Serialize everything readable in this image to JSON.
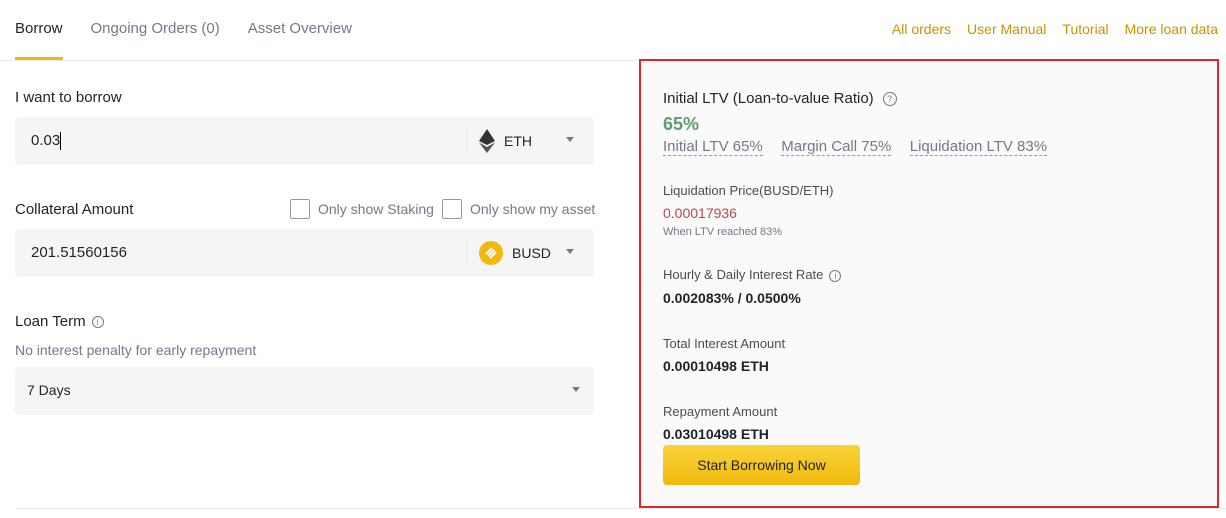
{
  "tabs": [
    "Borrow",
    "Ongoing Orders (0)",
    "Asset Overview"
  ],
  "links": [
    "All orders",
    "User Manual",
    "Tutorial",
    "More loan data"
  ],
  "borrow": {
    "label": "I want to borrow",
    "value": "0.03",
    "coin": "ETH"
  },
  "collateral": {
    "label": "Collateral Amount",
    "staking": "Only show Staking",
    "myasset": "Only show my asset",
    "value": "201.51560156",
    "coin": "BUSD"
  },
  "term": {
    "label": "Loan Term",
    "note": "No interest penalty for early repayment",
    "value": "7 Days"
  },
  "panel": {
    "ltv_title": "Initial LTV (Loan-to-value Ratio)",
    "ltv_value": "65%",
    "ltv_links": [
      "Initial LTV 65%",
      "Margin Call 75%",
      "Liquidation LTV 83%"
    ],
    "liq_label": "Liquidation Price(BUSD/ETH)",
    "liq_value": "0.00017936",
    "liq_note": "When LTV reached 83%",
    "rate_label": "Hourly & Daily Interest Rate",
    "rate_value": "0.002083% / 0.0500%",
    "interest_label": "Total Interest Amount",
    "interest_value": "0.00010498 ETH",
    "repay_label": "Repayment Amount",
    "repay_value": "0.03010498 ETH",
    "button": "Start Borrowing Now"
  },
  "colors": {
    "accent": "#f0b90b",
    "green": "#5a9e6f",
    "red": "#b5474f"
  }
}
